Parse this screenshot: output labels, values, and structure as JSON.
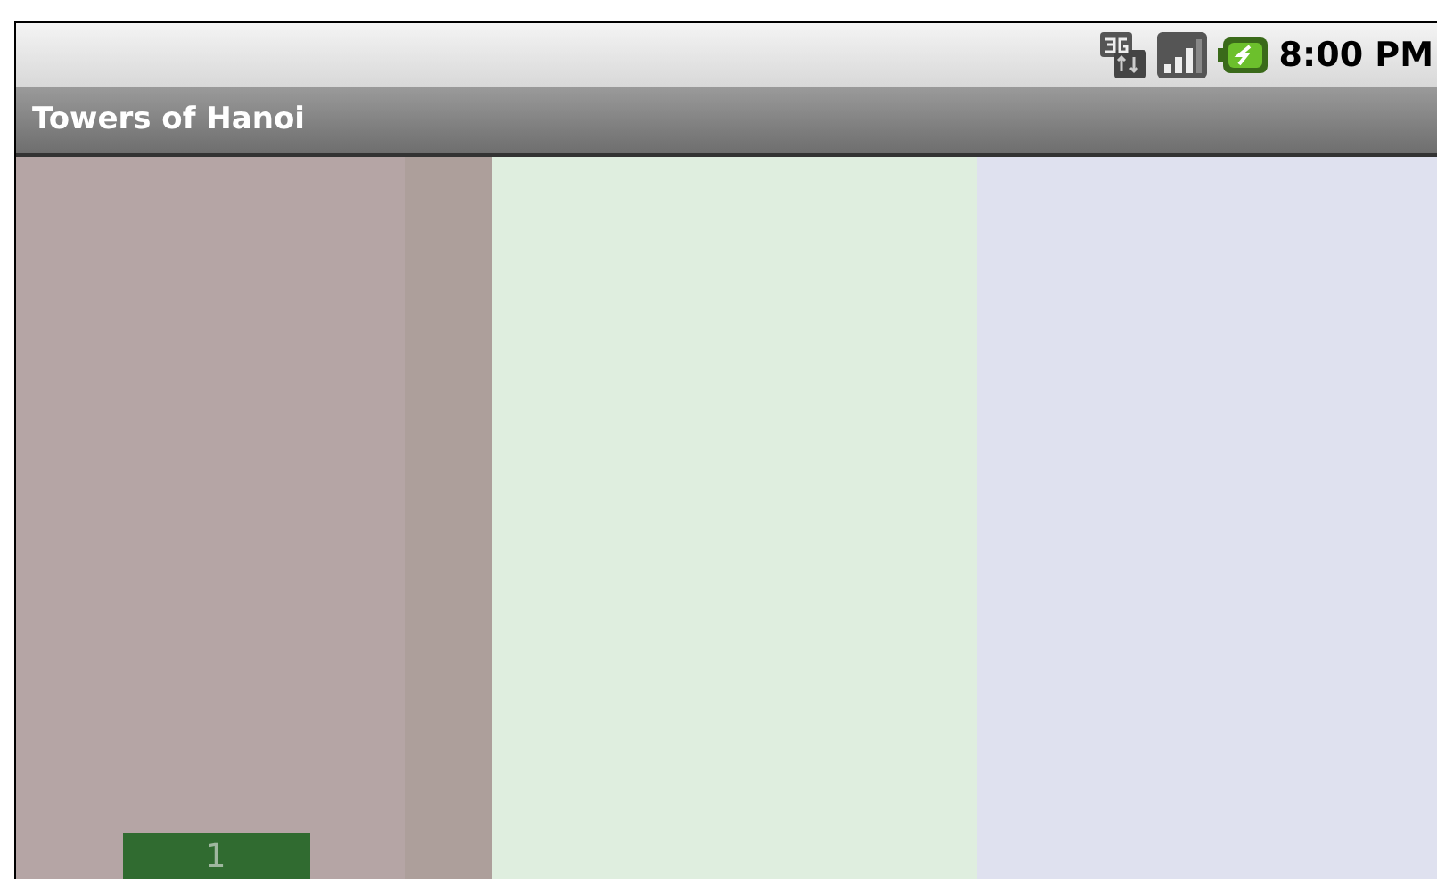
{
  "status_bar": {
    "time": "8:00 PM"
  },
  "title_bar": {
    "title": "Towers of Hanoi"
  },
  "pegs": [
    {
      "color": "#b5a5a5",
      "disks": [
        {
          "label": "1"
        }
      ]
    },
    {
      "color": "#dfeedf"
    },
    {
      "color": "#dfe1ef"
    }
  ]
}
